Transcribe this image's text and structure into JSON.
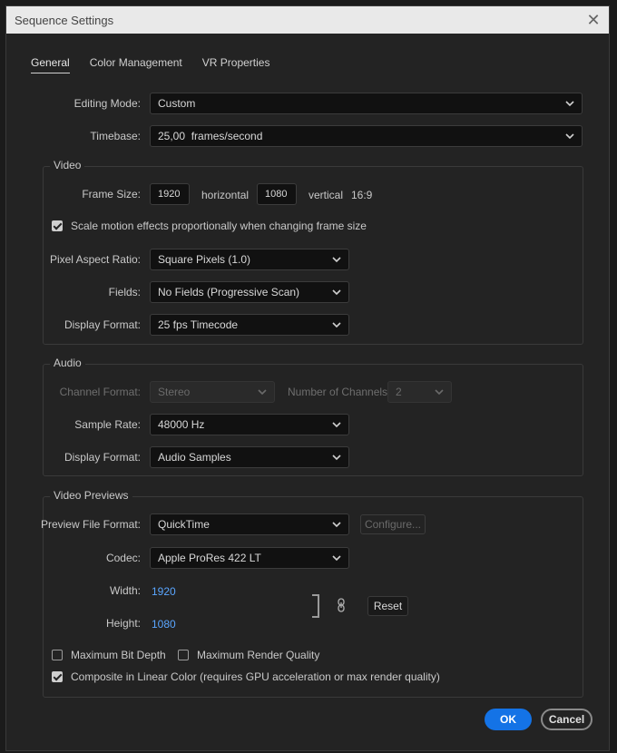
{
  "dialog": {
    "title": "Sequence Settings"
  },
  "tabs": [
    "General",
    "Color Management",
    "VR Properties"
  ],
  "general": {
    "editing_mode_label": "Editing Mode:",
    "editing_mode_value": "Custom",
    "timebase_label": "Timebase:",
    "timebase_value": "25,00  frames/second"
  },
  "video": {
    "title": "Video",
    "frame_size_label": "Frame Size:",
    "width": "1920",
    "horizontal_label": "horizontal",
    "height": "1080",
    "vertical_label": "vertical",
    "aspect": "16:9",
    "scale_motion_label": "Scale motion effects proportionally when changing frame size",
    "scale_motion_checked": true,
    "par_label": "Pixel Aspect Ratio:",
    "par_value": "Square Pixels (1.0)",
    "fields_label": "Fields:",
    "fields_value": "No Fields (Progressive Scan)",
    "display_format_label": "Display Format:",
    "display_format_value": "25 fps Timecode"
  },
  "audio": {
    "title": "Audio",
    "channel_format_label": "Channel Format:",
    "channel_format_value": "Stereo",
    "num_channels_label": "Number of Channels:",
    "num_channels_value": "2",
    "sample_rate_label": "Sample Rate:",
    "sample_rate_value": "48000 Hz",
    "display_format_label": "Display Format:",
    "display_format_value": "Audio Samples"
  },
  "previews": {
    "title": "Video Previews",
    "file_format_label": "Preview File Format:",
    "file_format_value": "QuickTime",
    "configure_label": "Configure...",
    "codec_label": "Codec:",
    "codec_value": "Apple ProRes 422 LT",
    "width_label": "Width:",
    "width_value": "1920",
    "height_label": "Height:",
    "height_value": "1080",
    "reset_label": "Reset",
    "max_bit_depth_label": "Maximum Bit Depth",
    "max_bit_depth_checked": false,
    "max_render_label": "Maximum Render Quality",
    "max_render_checked": false,
    "linear_color_label": "Composite in Linear Color (requires GPU acceleration or max render quality)",
    "linear_color_checked": true
  },
  "footer": {
    "ok_label": "OK",
    "cancel_label": "Cancel"
  },
  "colors": {
    "accent": "#1473e6",
    "link": "#5aa6ff",
    "dialog_bg": "#232323",
    "titlebar_bg": "#e9e9e9"
  },
  "icons": {
    "close": "close-icon",
    "chevron": "chevron-down-icon",
    "link": "link-icon",
    "check": "checkmark-icon"
  }
}
